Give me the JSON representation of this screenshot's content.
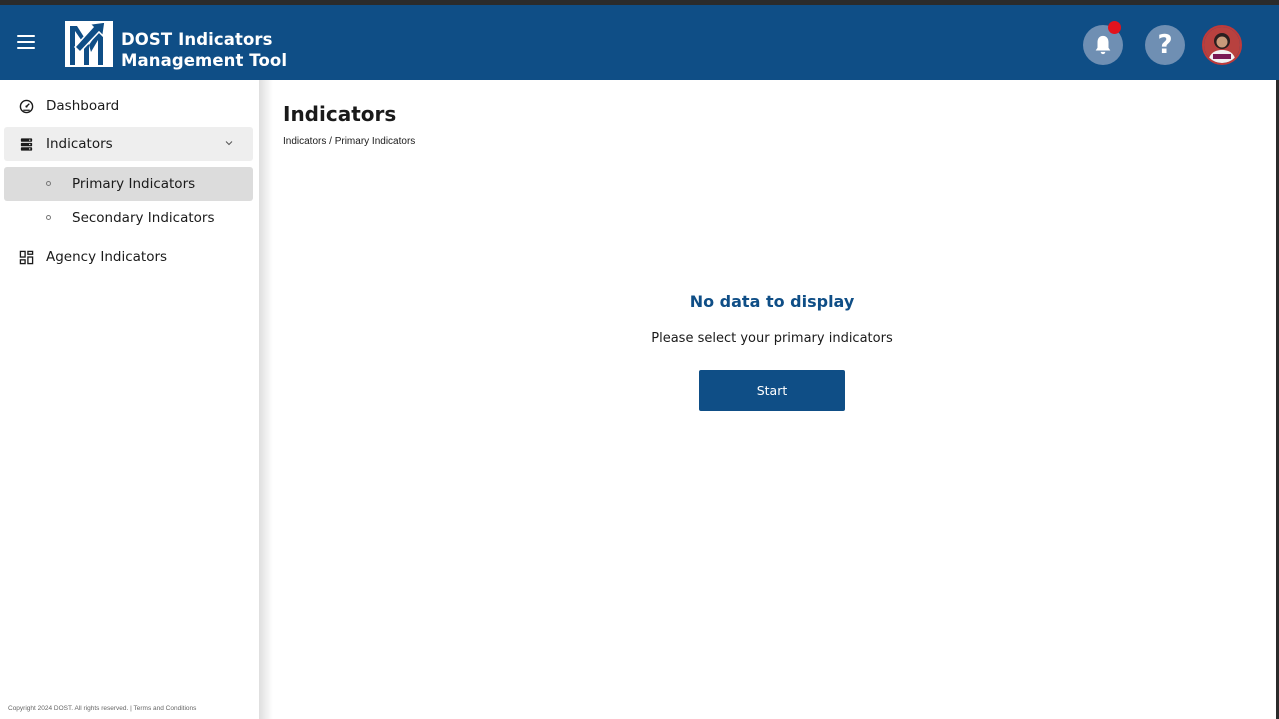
{
  "header": {
    "brand_line1": "DOST Indicators",
    "brand_line2": "Management Tool",
    "notification_icon": "bell-icon",
    "help_icon": "question-mark-icon",
    "help_glyph": "?",
    "has_unread_notification": true,
    "colors": {
      "header_bg": "#0f4e86",
      "icon_bg": "#6f8fb3",
      "notification_dot": "#e3131d"
    }
  },
  "sidebar": {
    "items": [
      {
        "label": "Dashboard",
        "icon": "dashboard-gauge-icon"
      },
      {
        "label": "Indicators",
        "icon": "server-stack-icon",
        "expanded": true,
        "children": [
          {
            "label": "Primary Indicators",
            "active": true
          },
          {
            "label": "Secondary Indicators",
            "active": false
          }
        ]
      },
      {
        "label": "Agency Indicators",
        "icon": "grid-icon"
      }
    ],
    "copyright": "Copyright 2024 DOST. All rights reserved.",
    "separator": "|",
    "terms_label": "Terms and Conditions"
  },
  "main": {
    "title": "Indicators",
    "breadcrumb": {
      "parent": "Indicators",
      "separator": "/",
      "current": "Primary Indicators"
    },
    "empty_state": {
      "title": "No data to display",
      "subtitle": "Please select your primary indicators",
      "button_label": "Start"
    }
  }
}
